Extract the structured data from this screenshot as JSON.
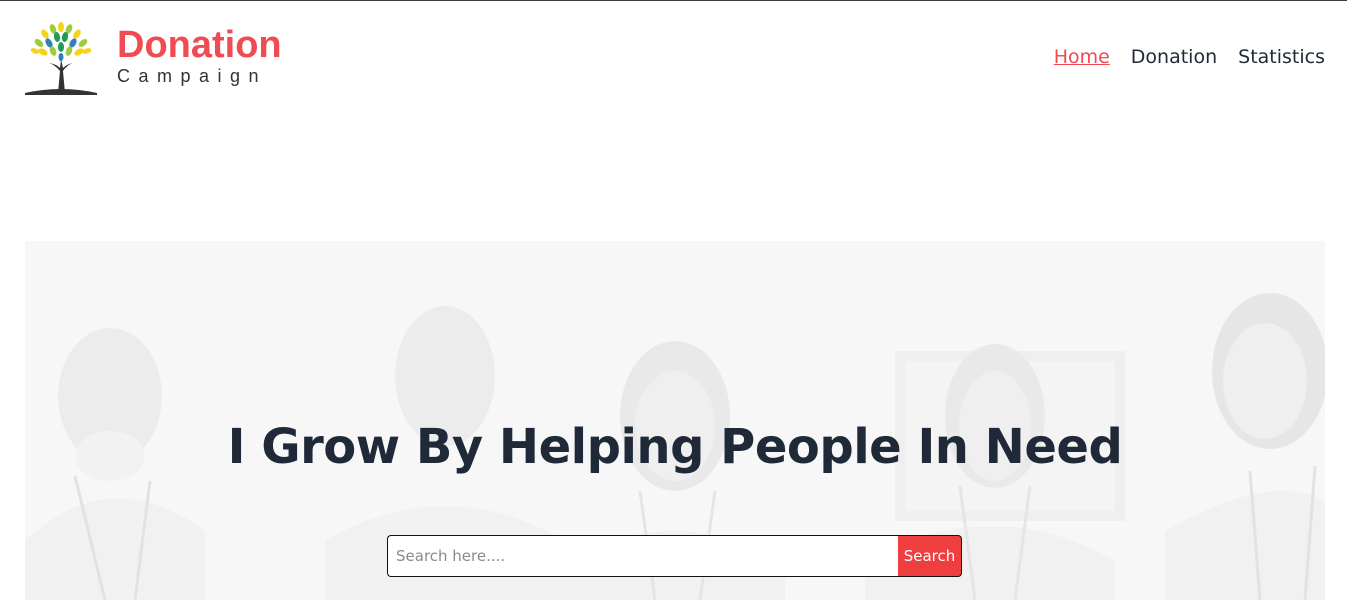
{
  "brand": {
    "title": "Donation",
    "subtitle": "Campaign",
    "logo_icon": "tree-logo-icon",
    "accent_color": "#f04a52"
  },
  "nav": {
    "items": [
      {
        "label": "Home",
        "active": true
      },
      {
        "label": "Donation",
        "active": false
      },
      {
        "label": "Statistics",
        "active": false
      }
    ]
  },
  "hero": {
    "title": "I Grow By Helping People In Need",
    "search": {
      "placeholder": "Search here....",
      "value": "",
      "button_label": "Search",
      "button_color": "#ef3e40"
    }
  }
}
